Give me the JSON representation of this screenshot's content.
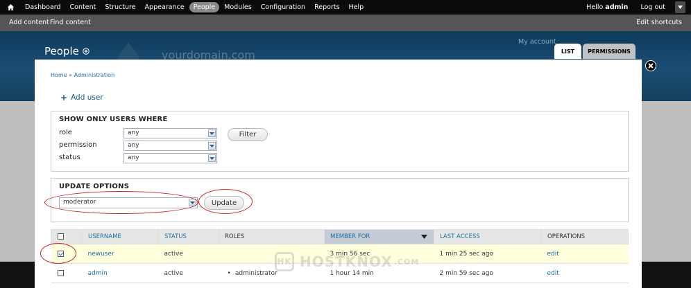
{
  "toolbar": {
    "menu": [
      "Dashboard",
      "Content",
      "Structure",
      "Appearance",
      "People",
      "Modules",
      "Configuration",
      "Reports",
      "Help"
    ],
    "active": "People",
    "hello": "Hello",
    "username": "admin",
    "logout": "Log out"
  },
  "shortcuts": {
    "items": [
      "Add content",
      "Find content"
    ],
    "edit": "Edit shortcuts"
  },
  "header": {
    "title": "People",
    "site_name": "yourdomain.com",
    "my_account": "My account",
    "tabs": [
      "LIST",
      "PERMISSIONS"
    ]
  },
  "breadcrumb": "Home » Administration",
  "add_user": "Add user",
  "filters": {
    "legend": "SHOW ONLY USERS WHERE",
    "rows": [
      {
        "label": "role",
        "value": "any"
      },
      {
        "label": "permission",
        "value": "any"
      },
      {
        "label": "status",
        "value": "any"
      }
    ],
    "button": "Filter"
  },
  "update_options": {
    "legend": "UPDATE OPTIONS",
    "value": "moderator",
    "button": "Update"
  },
  "table": {
    "headers": [
      "USERNAME",
      "STATUS",
      "ROLES",
      "MEMBER FOR",
      "LAST ACCESS",
      "OPERATIONS"
    ],
    "rows": [
      {
        "checked": true,
        "username": "newuser",
        "status": "active",
        "roles": "",
        "member_for": "3 min 56 sec",
        "last_access": "1 min 25 sec ago",
        "operation": "edit"
      },
      {
        "checked": false,
        "username": "admin",
        "status": "active",
        "roles": "administrator",
        "member_for": "1 hour 14 min",
        "last_access": "2 min 59 sec ago",
        "operation": "edit"
      }
    ]
  },
  "watermark": {
    "mark": "HK",
    "text": "HOSTKNOX",
    "suffix": ".COM"
  },
  "colors": {
    "link": "#1a6fa5",
    "annotation": "#d02020",
    "selected_row": "#ffffdd"
  }
}
